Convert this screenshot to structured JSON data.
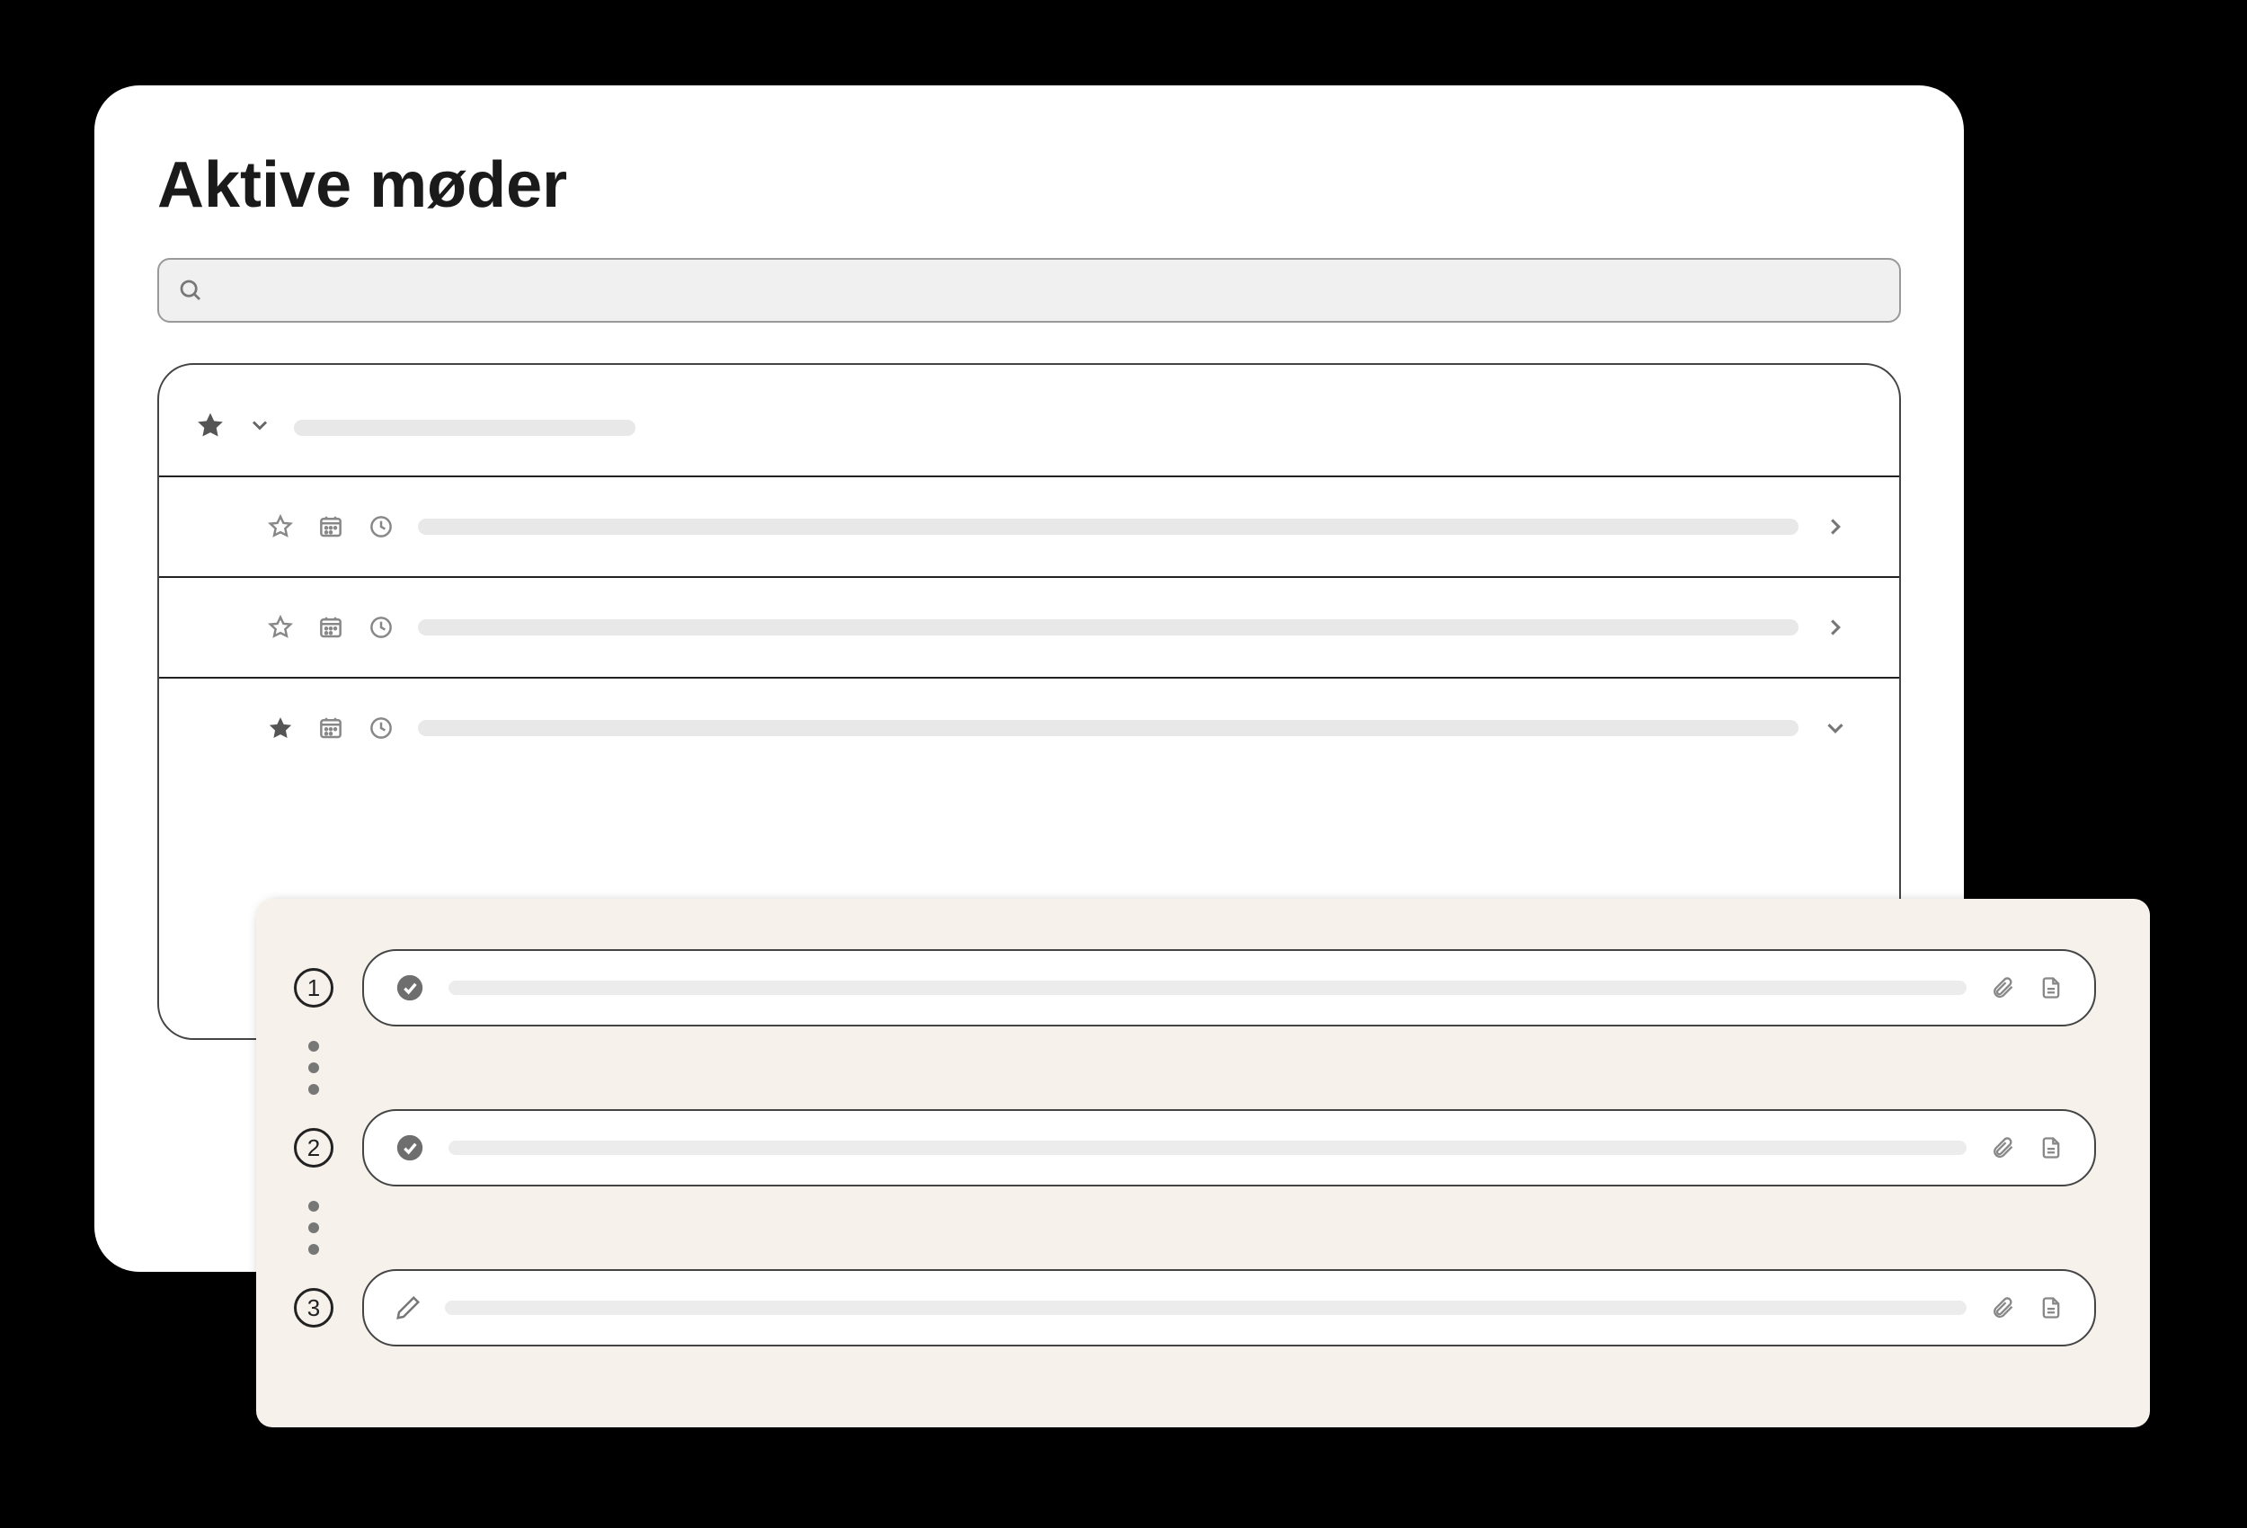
{
  "page": {
    "title": "Aktive møder"
  },
  "search": {
    "placeholder": ""
  },
  "group": {
    "starred": true,
    "expanded": true
  },
  "rows": [
    {
      "starred": false,
      "action": "chevron-right"
    },
    {
      "starred": false,
      "action": "chevron-right"
    },
    {
      "starred": true,
      "action": "chevron-down"
    }
  ],
  "steps": [
    {
      "number": "1",
      "status": "check"
    },
    {
      "number": "2",
      "status": "check"
    },
    {
      "number": "3",
      "status": "edit"
    }
  ]
}
